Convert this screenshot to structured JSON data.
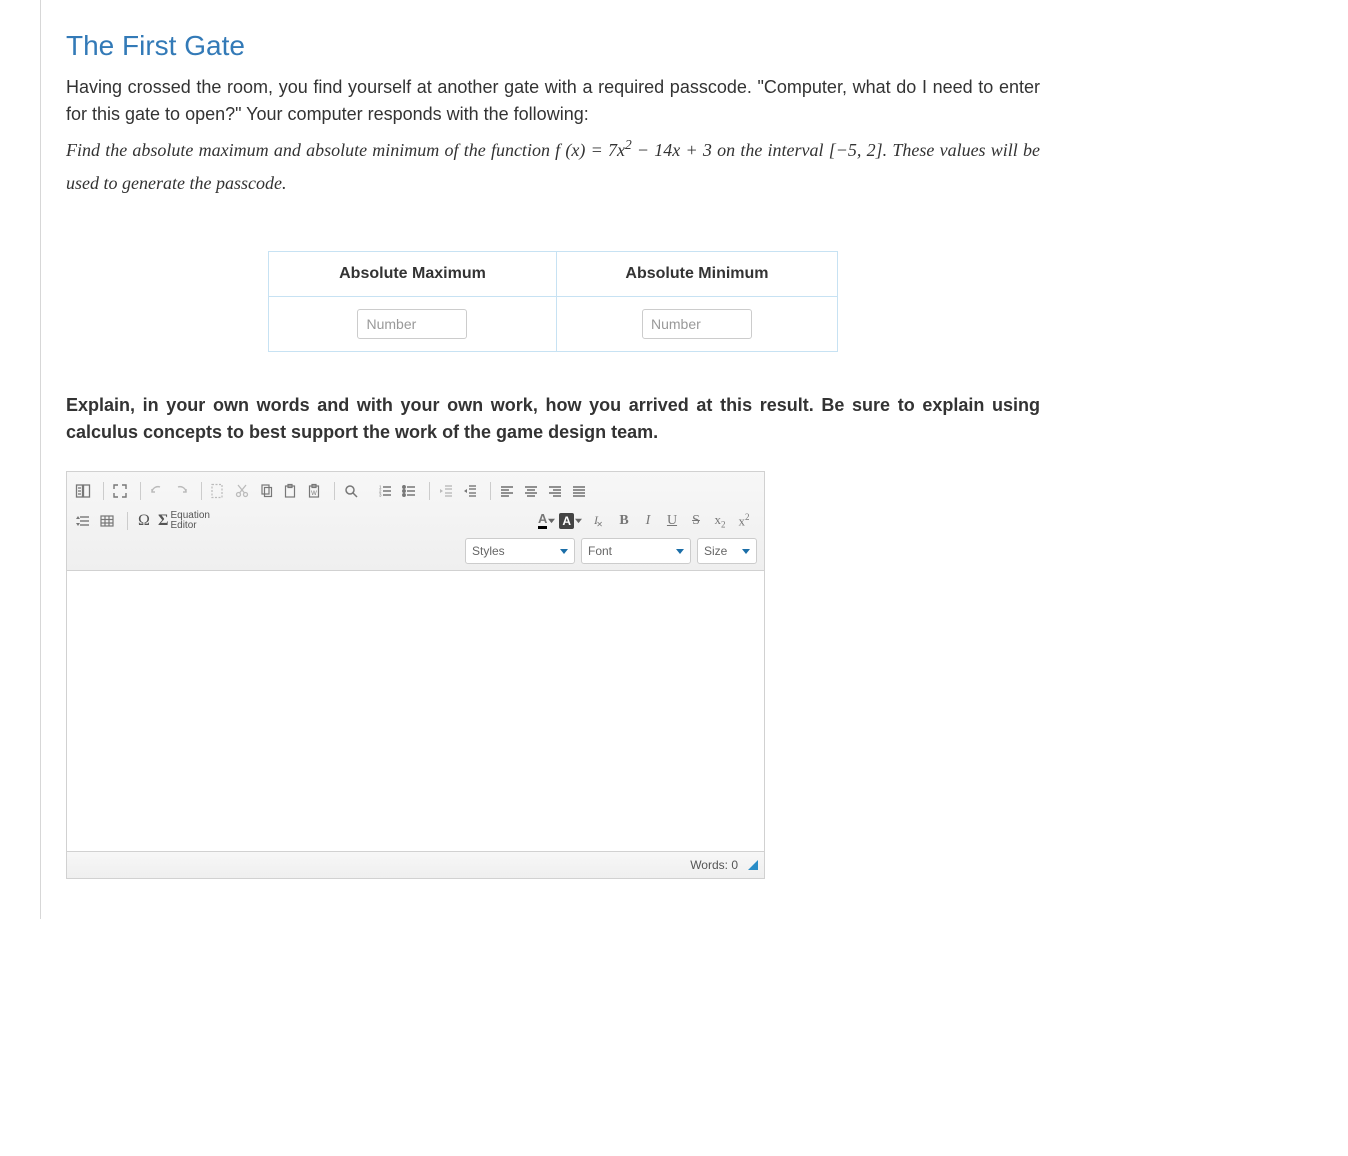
{
  "title": "The First Gate",
  "intro": "Having crossed the room, you find yourself at another gate with a required passcode. \"Computer, what do I need to enter for this gate to open?\" Your computer responds with the following:",
  "prompt_pre": "Find the absolute maximum and absolute minimum of the function ",
  "prompt_fn": "f (x) = 7x",
  "prompt_exp": "2",
  "prompt_after_fn": " − 14x + 3",
  "prompt_mid": " on the interval ",
  "prompt_interval": "[−5, 2]",
  "prompt_post": ". These values will be used to generate the passcode.",
  "table": {
    "max_header": "Absolute Maximum",
    "min_header": "Absolute Minimum",
    "placeholder": "Number"
  },
  "explain": "Explain, in your own words and with your own work, how you arrived at this result. Be sure to explain using calculus concepts to best support the work of the game design team.",
  "editor": {
    "eq_label_top": "Equation",
    "eq_label_bot": "Editor",
    "styles": "Styles",
    "font": "Font",
    "size": "Size",
    "words_label": "Words: ",
    "words_count": "0"
  }
}
